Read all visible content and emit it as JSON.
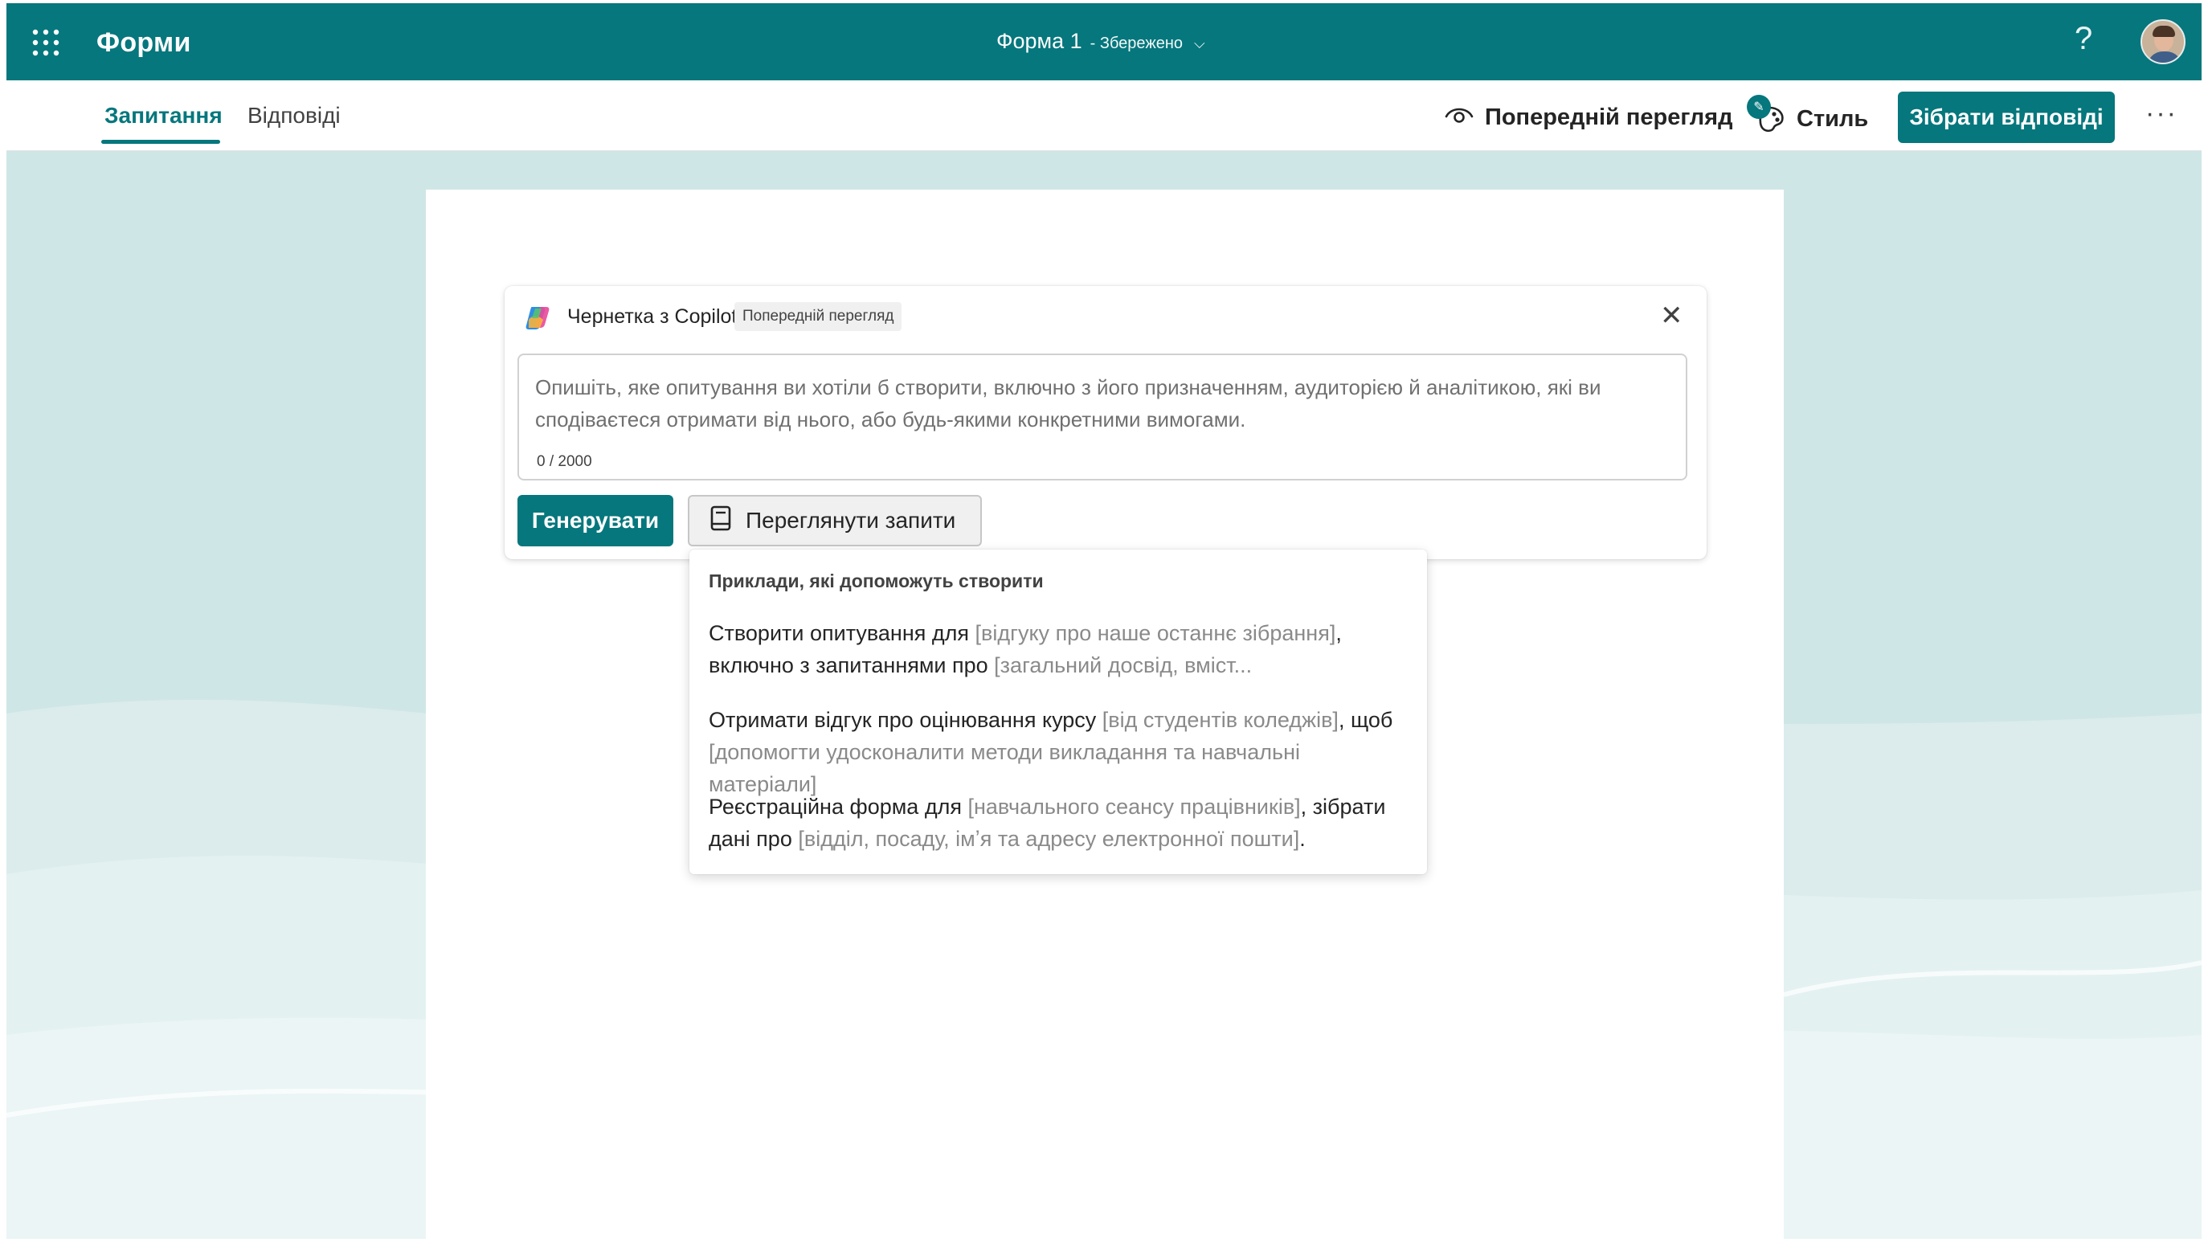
{
  "topbar": {
    "app_name": "Форми",
    "doc_title": "Форма 1",
    "doc_saved": "- Збережено",
    "help": "?"
  },
  "tabs": [
    {
      "label": "Запитання",
      "active": true
    },
    {
      "label": "Відповіді",
      "active": false
    }
  ],
  "toolbar": {
    "preview_label": "Попередній перегляд",
    "style_label": "Стиль",
    "collect_label": "Зібрати відповіді",
    "more": "···"
  },
  "copilot": {
    "title": "Чернетка з Copilot",
    "badge": "Попередній перегляд",
    "placeholder": "Опишіть, яке опитування ви хотіли б створити, включно з його призначенням, аудиторією й аналітикою, які ви сподіваєтеся отримати від нього, або будь-якими конкретними вимогами.",
    "counter": "0 / 2000",
    "generate_label": "Генерувати",
    "view_prompts_label": "Переглянути запити"
  },
  "prompt_menu": {
    "heading": "Приклади, які допоможуть створити",
    "items": [
      {
        "a": "Створити опитування для ",
        "b": "[відгуку про наше останнє зібрання]",
        "c": ", включно з запитаннями про ",
        "d": "[загальний досвід, вміст...",
        "e": ""
      },
      {
        "a": "Отримати відгук про оцінювання курсу ",
        "b": "[від студентів коледжів]",
        "c": ", щоб ",
        "d": "[допомогти удосконалити методи викладання та навчальні матеріали]",
        "e": ""
      },
      {
        "a": "Реєстраційна форма для ",
        "b": "[навчального сеансу працівників]",
        "c": ", зібрати дані про ",
        "d": "[відділ, посаду, імʼя та адресу електронної пошти]",
        "e": "."
      }
    ]
  },
  "colors": {
    "brand": "#05777d",
    "canvas": "#cfe6e6"
  }
}
